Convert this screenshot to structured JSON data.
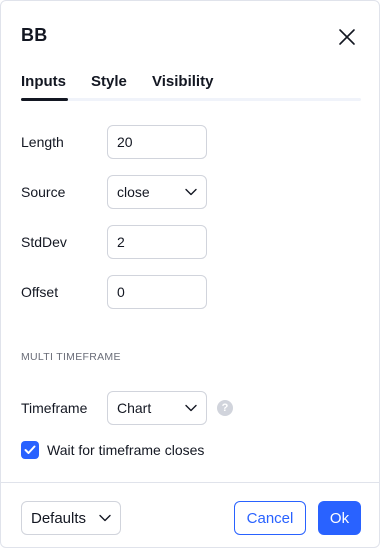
{
  "dialog": {
    "title": "BB",
    "close_icon": "close-icon"
  },
  "tabs": [
    {
      "label": "Inputs",
      "active": true
    },
    {
      "label": "Style",
      "active": false
    },
    {
      "label": "Visibility",
      "active": false
    }
  ],
  "inputs": {
    "length": {
      "label": "Length",
      "value": "20"
    },
    "source": {
      "label": "Source",
      "value": "close"
    },
    "stddev": {
      "label": "StdDev",
      "value": "2"
    },
    "offset": {
      "label": "Offset",
      "value": "0"
    }
  },
  "multi_timeframe": {
    "header": "MULTI TIMEFRAME",
    "timeframe": {
      "label": "Timeframe",
      "value": "Chart"
    },
    "help_icon": "question-circle-icon",
    "help_glyph": "?",
    "wait_closes": {
      "label": "Wait for timeframe closes",
      "checked": true
    }
  },
  "footer": {
    "defaults_label": "Defaults",
    "cancel_label": "Cancel",
    "ok_label": "Ok"
  },
  "colors": {
    "accent": "#2962ff",
    "text": "#131722",
    "border": "#d1d4dc",
    "muted": "#6a6d78"
  }
}
